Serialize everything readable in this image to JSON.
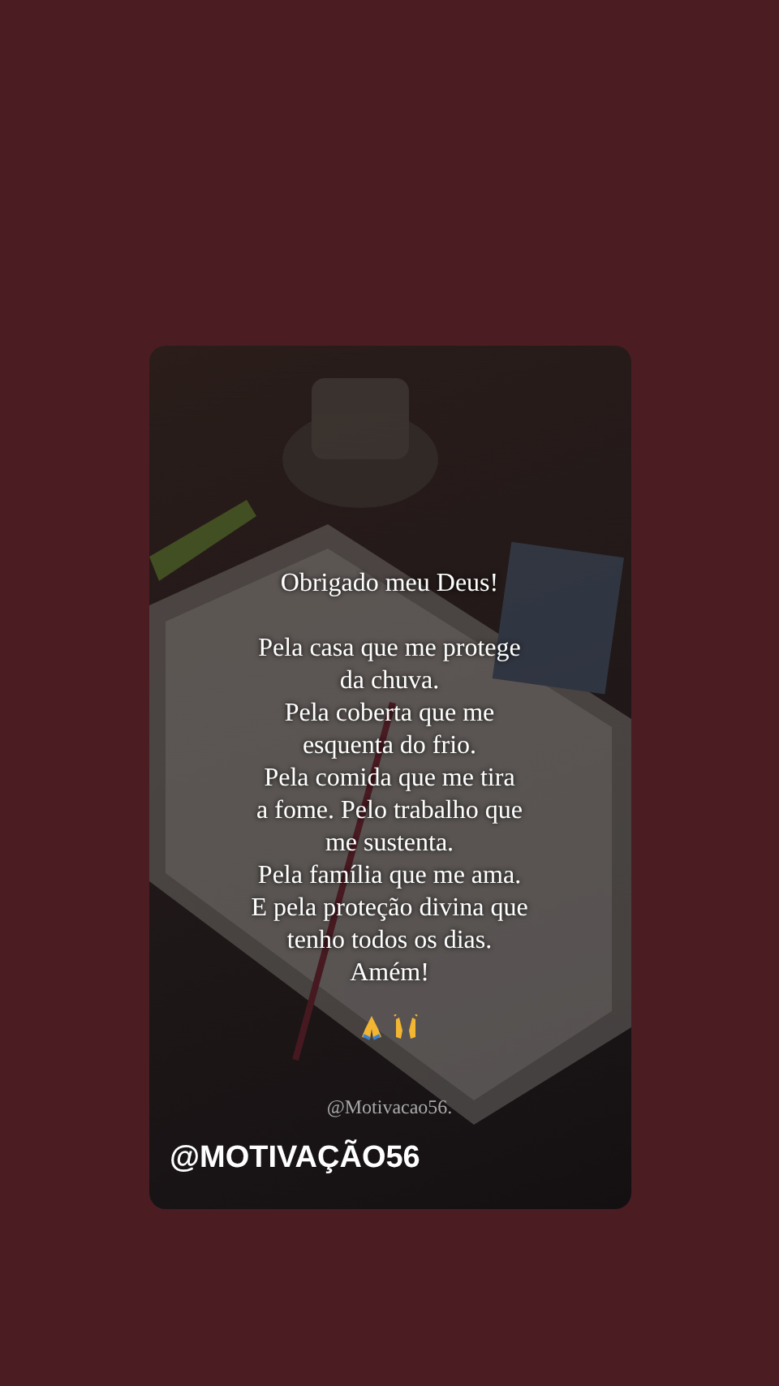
{
  "post": {
    "title": "Obrigado meu Deus!",
    "lines": [
      "Pela casa que me protege",
      "da chuva.",
      "Pela coberta que me",
      "esquenta do frio.",
      "Pela comida que me tira",
      "a fome. Pelo trabalho que",
      "me sustenta.",
      "Pela família que me ama.",
      "E pela proteção divina que",
      "tenho todos os dias.",
      "Amém!"
    ],
    "credit": "@Motivacao56.",
    "handle": "@MOTIVAÇÃO56"
  }
}
